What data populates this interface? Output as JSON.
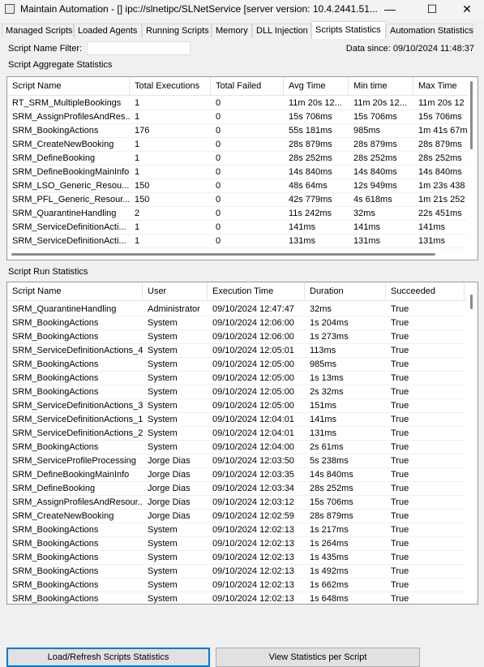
{
  "window": {
    "title": "Maintain Automation - [] ipc://slnetipc/SLNetService [server version: 10.4.2441.51...",
    "minimize_glyph": "—",
    "maximize_glyph": "☐",
    "close_glyph": "✕"
  },
  "tabs": [
    {
      "label": "Managed Scripts"
    },
    {
      "label": "Loaded Agents"
    },
    {
      "label": "Running Scripts"
    },
    {
      "label": "Memory"
    },
    {
      "label": "DLL Injection"
    },
    {
      "label": "Scripts Statistics",
      "active": true
    },
    {
      "label": "Automation Statistics"
    }
  ],
  "filter": {
    "label": "Script Name Filter:",
    "value": ""
  },
  "data_since": "Data since: 09/10/2024 11:48:37",
  "aggregate": {
    "title": "Script Aggregate Statistics",
    "columns": [
      "Script Name",
      "Total Executions",
      "Total Failed",
      "Avg Time",
      "Min time",
      "Max Time"
    ],
    "rows": [
      [
        "RT_SRM_MultipleBookings",
        "1",
        "0",
        "11m 20s 12...",
        "11m 20s 12...",
        "11m 20s 12"
      ],
      [
        "SRM_AssignProfilesAndRes...",
        "1",
        "0",
        "15s 706ms",
        "15s 706ms",
        "15s 706ms"
      ],
      [
        "SRM_BookingActions",
        "176",
        "0",
        "55s 181ms",
        "985ms",
        "1m 41s 67m"
      ],
      [
        "SRM_CreateNewBooking",
        "1",
        "0",
        "28s 879ms",
        "28s 879ms",
        "28s 879ms"
      ],
      [
        "SRM_DefineBooking",
        "1",
        "0",
        "28s 252ms",
        "28s 252ms",
        "28s 252ms"
      ],
      [
        "SRM_DefineBookingMainInfo",
        "1",
        "0",
        "14s 840ms",
        "14s 840ms",
        "14s 840ms"
      ],
      [
        "SRM_LSO_Generic_Resou...",
        "150",
        "0",
        "48s 64ms",
        "12s 949ms",
        "1m 23s 438"
      ],
      [
        "SRM_PFL_Generic_Resour...",
        "150",
        "0",
        "42s 779ms",
        "4s 618ms",
        "1m 21s 252"
      ],
      [
        "SRM_QuarantineHandling",
        "2",
        "0",
        "11s 242ms",
        "32ms",
        "22s 451ms"
      ],
      [
        "SRM_ServiceDefinitionActi...",
        "1",
        "0",
        "141ms",
        "141ms",
        "141ms"
      ],
      [
        "SRM_ServiceDefinitionActi...",
        "1",
        "0",
        "131ms",
        "131ms",
        "131ms"
      ]
    ]
  },
  "runs": {
    "title": "Script Run Statistics",
    "columns": [
      "Script Name",
      "User",
      "Execution Time",
      "Duration",
      "Succeeded"
    ],
    "rows": [
      [
        "SRM_QuarantineHandling",
        "Administrator",
        "09/10/2024 12:47:47",
        "32ms",
        "True"
      ],
      [
        "SRM_BookingActions",
        "System",
        "09/10/2024 12:06:00",
        "1s 204ms",
        "True"
      ],
      [
        "SRM_BookingActions",
        "System",
        "09/10/2024 12:06:00",
        "1s 273ms",
        "True"
      ],
      [
        "SRM_ServiceDefinitionActions_4",
        "System",
        "09/10/2024 12:05:01",
        "113ms",
        "True"
      ],
      [
        "SRM_BookingActions",
        "System",
        "09/10/2024 12:05:00",
        "985ms",
        "True"
      ],
      [
        "SRM_BookingActions",
        "System",
        "09/10/2024 12:05:00",
        "1s 13ms",
        "True"
      ],
      [
        "SRM_BookingActions",
        "System",
        "09/10/2024 12:05:00",
        "2s 32ms",
        "True"
      ],
      [
        "SRM_ServiceDefinitionActions_3",
        "System",
        "09/10/2024 12:05:00",
        "151ms",
        "True"
      ],
      [
        "SRM_ServiceDefinitionActions_1",
        "System",
        "09/10/2024 12:04:01",
        "141ms",
        "True"
      ],
      [
        "SRM_ServiceDefinitionActions_2",
        "System",
        "09/10/2024 12:04:01",
        "131ms",
        "True"
      ],
      [
        "SRM_BookingActions",
        "System",
        "09/10/2024 12:04:00",
        "2s 61ms",
        "True"
      ],
      [
        "SRM_ServiceProfileProcessing",
        "Jorge Dias",
        "09/10/2024 12:03:50",
        "5s 238ms",
        "True"
      ],
      [
        "SRM_DefineBookingMainInfo",
        "Jorge Dias",
        "09/10/2024 12:03:35",
        "14s 840ms",
        "True"
      ],
      [
        "SRM_DefineBooking",
        "Jorge Dias",
        "09/10/2024 12:03:34",
        "28s 252ms",
        "True"
      ],
      [
        "SRM_AssignProfilesAndResour...",
        "Jorge Dias",
        "09/10/2024 12:03:12",
        "15s 706ms",
        "True"
      ],
      [
        "SRM_CreateNewBooking",
        "Jorge Dias",
        "09/10/2024 12:02:59",
        "28s 879ms",
        "True"
      ],
      [
        "SRM_BookingActions",
        "System",
        "09/10/2024 12:02:13",
        "1s 217ms",
        "True"
      ],
      [
        "SRM_BookingActions",
        "System",
        "09/10/2024 12:02:13",
        "1s 264ms",
        "True"
      ],
      [
        "SRM_BookingActions",
        "System",
        "09/10/2024 12:02:13",
        "1s 435ms",
        "True"
      ],
      [
        "SRM_BookingActions",
        "System",
        "09/10/2024 12:02:13",
        "1s 492ms",
        "True"
      ],
      [
        "SRM_BookingActions",
        "System",
        "09/10/2024 12:02:13",
        "1s 662ms",
        "True"
      ],
      [
        "SRM_BookingActions",
        "System",
        "09/10/2024 12:02:13",
        "1s 648ms",
        "True"
      ]
    ]
  },
  "buttons": {
    "refresh": "Load/Refresh Scripts Statistics",
    "per_script": "View Statistics per Script"
  }
}
